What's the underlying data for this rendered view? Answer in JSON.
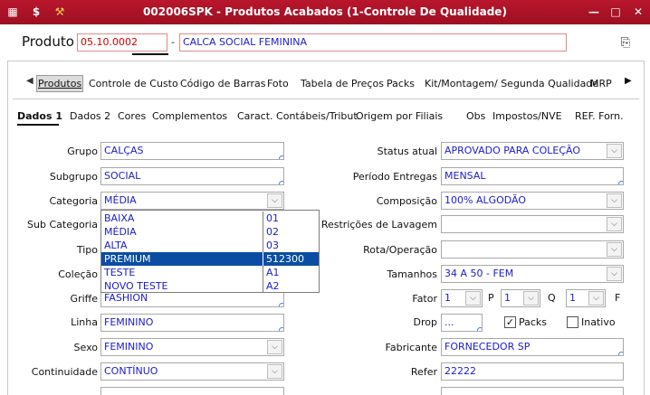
{
  "window": {
    "title": "002006SPK - Produtos Acabados (1-Controle De Qualidade)",
    "icons": [
      "grid-menu-icon",
      "app-logo-icon",
      "wrench-icon"
    ],
    "minimize": "—",
    "maximize": "□",
    "close": "✕"
  },
  "product": {
    "label": "Produto",
    "code": "05.10.0002",
    "separator": "-",
    "name": "CALCA SOCIAL FEMININA",
    "copy_icon": "copy-icon"
  },
  "tabs_main": [
    {
      "label": "Produtos",
      "active": true
    },
    {
      "label": "Controle de Custo"
    },
    {
      "label": "Código de Barras"
    },
    {
      "label": "Foto"
    },
    {
      "label": "Tabela de Preços"
    },
    {
      "label": "Packs"
    },
    {
      "label": "Kit/Montagem/ Segunda Qualidade"
    },
    {
      "label": "MRP"
    }
  ],
  "tabs_sub": [
    {
      "label": "Dados 1",
      "active": true
    },
    {
      "label": "Dados 2"
    },
    {
      "label": "Cores"
    },
    {
      "label": "Complementos"
    },
    {
      "label": "Caract. Contábeis/Tribut."
    },
    {
      "label": "Origem por Filiais"
    },
    {
      "label": "Obs"
    },
    {
      "label": "Impostos/NVE"
    },
    {
      "label": "REF. Forn."
    }
  ],
  "left_fields": {
    "grupo": {
      "label": "Grupo",
      "value": "CALÇAS"
    },
    "subgrupo": {
      "label": "Subgrupo",
      "value": "SOCIAL"
    },
    "categoria": {
      "label": "Categoria",
      "value": "MÉDIA"
    },
    "subcategoria": {
      "label": "Sub Categoria"
    },
    "tipo": {
      "label": "Tipo"
    },
    "colecao": {
      "label": "Coleção"
    },
    "griffe": {
      "label": "Griffe",
      "value": "FASHION"
    },
    "linha": {
      "label": "Linha",
      "value": "FEMININO"
    },
    "sexo": {
      "label": "Sexo",
      "value": "FEMININO"
    },
    "continuidade": {
      "label": "Continuidade",
      "value": "CONTÍNUO"
    }
  },
  "category_dropdown": [
    {
      "name": "BAIXA",
      "code": "01"
    },
    {
      "name": "MÉDIA",
      "code": "02"
    },
    {
      "name": "ALTA",
      "code": "03"
    },
    {
      "name": "PREMIUM",
      "code": "512300",
      "selected": true
    },
    {
      "name": "TESTE",
      "code": "A1"
    },
    {
      "name": "NOVO TESTE",
      "code": "A2"
    }
  ],
  "right_fields": {
    "status": {
      "label": "Status atual",
      "value": "APROVADO PARA COLEÇÃO"
    },
    "periodo": {
      "label": "Período Entregas",
      "value": "MENSAL"
    },
    "composicao": {
      "label": "Composição",
      "value": "100% ALGODÃO"
    },
    "restricoes": {
      "label": "Restrições de Lavagem"
    },
    "rota": {
      "label": "Rota/Operação"
    },
    "tamanhos": {
      "label": "Tamanhos",
      "value": "34 A 50 - FEM"
    },
    "fator": {
      "label": "Fator",
      "value": "1",
      "p_label": "P",
      "p_value": "1",
      "q_label": "Q",
      "q_value": "1",
      "f_label": "F"
    },
    "drop": {
      "label": "Drop",
      "value": "...",
      "packs_label": "Packs",
      "packs_checked": true,
      "inativo_label": "Inativo",
      "inativo_checked": false
    },
    "fabricante": {
      "label": "Fabricante",
      "value": "FORNECEDOR SP"
    },
    "refer": {
      "label": "Refer",
      "value": "22222"
    }
  },
  "colors": {
    "titlebar": "#b01428",
    "accent_text": "#1c1ccc",
    "selected_row": "#0a4ea3",
    "code_red": "#d10000"
  }
}
